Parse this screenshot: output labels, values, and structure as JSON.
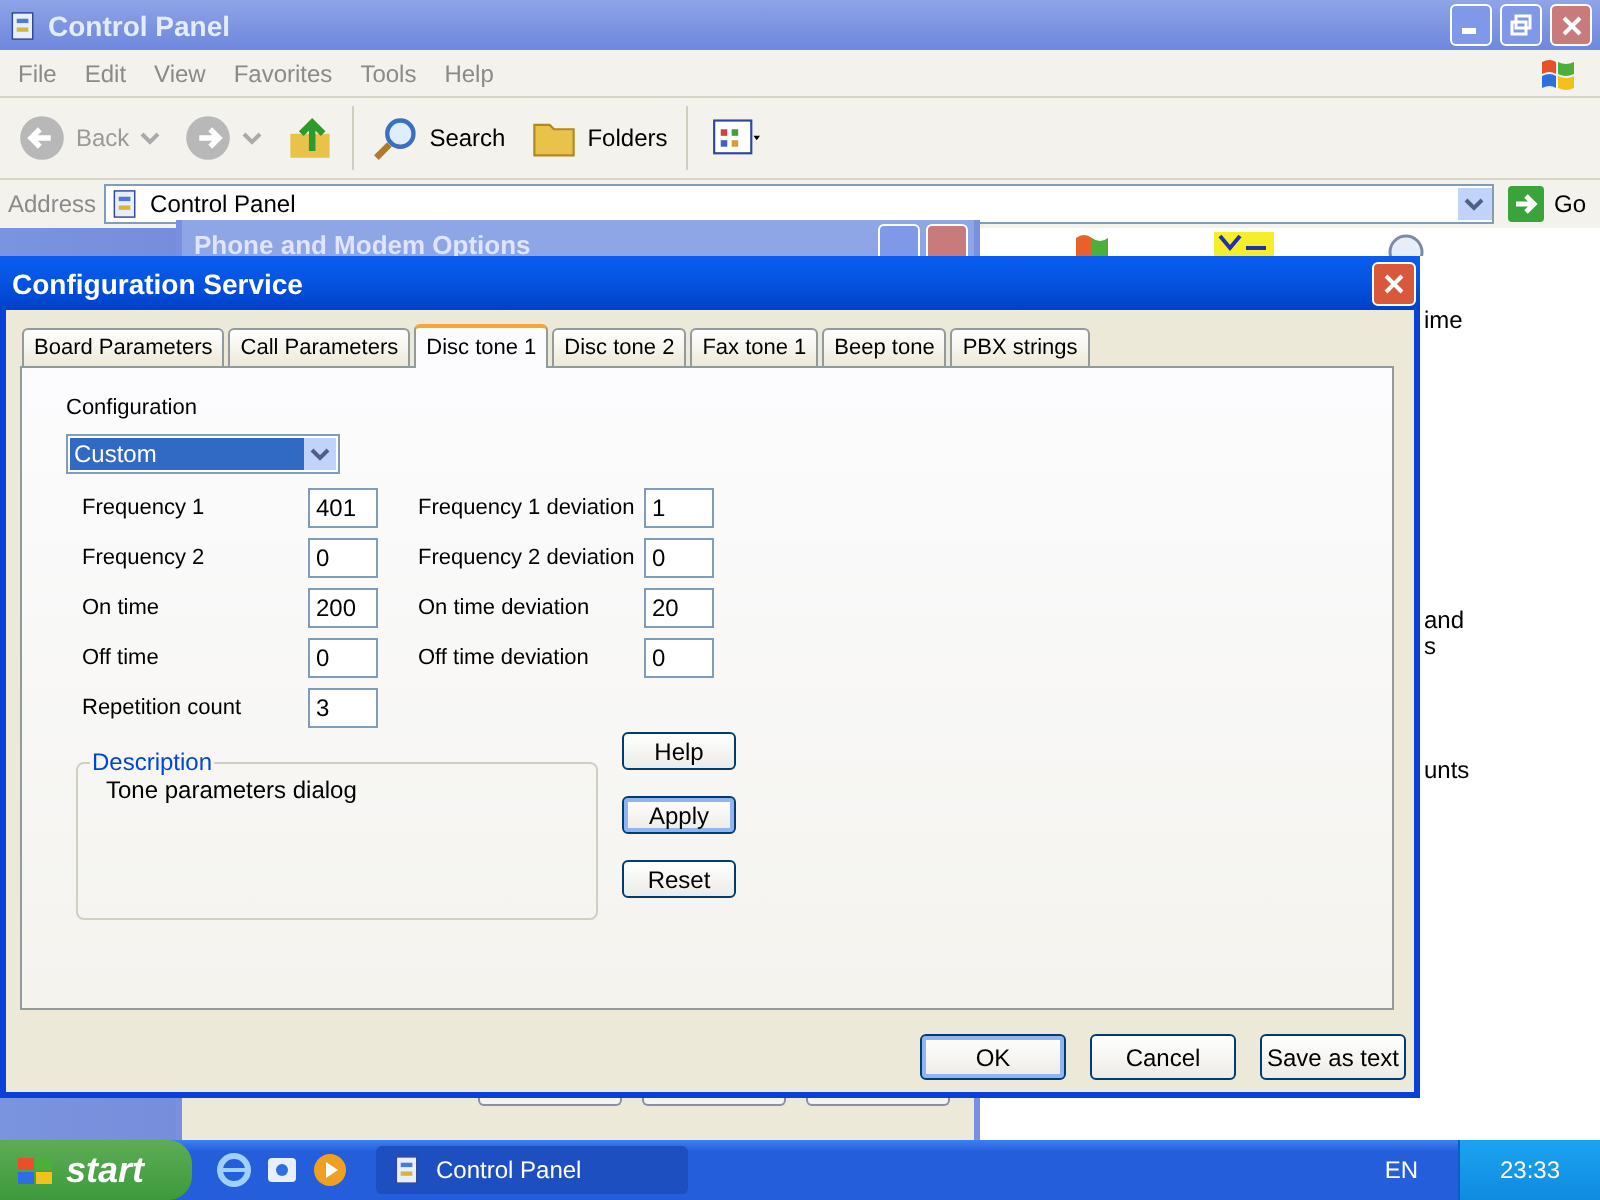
{
  "explorer": {
    "title": "Control Panel",
    "menu": [
      "File",
      "Edit",
      "View",
      "Favorites",
      "Tools",
      "Help"
    ],
    "toolbar": [
      {
        "kind": "back",
        "label": "Back"
      },
      {
        "kind": "forward"
      },
      {
        "kind": "up"
      },
      {
        "kind": "search",
        "label": "Search"
      },
      {
        "kind": "folders",
        "label": "Folders"
      },
      {
        "kind": "views"
      }
    ],
    "address_label": "Address",
    "address": "Control Panel",
    "go": "Go",
    "fragments": [
      "ime",
      "and",
      "s",
      "unts"
    ]
  },
  "background_window": {
    "title": "Phone and Modem Options"
  },
  "dialog": {
    "title": "Configuration Service",
    "tabs": [
      {
        "label": "Board Parameters",
        "selected": false
      },
      {
        "label": "Call Parameters",
        "selected": false
      },
      {
        "label": "Disc tone 1",
        "selected": true
      },
      {
        "label": "Disc tone 2",
        "selected": false
      },
      {
        "label": "Fax tone 1",
        "selected": false
      },
      {
        "label": "Beep tone",
        "selected": false
      },
      {
        "label": "PBX strings",
        "selected": false
      }
    ],
    "configuration_label": "Configuration",
    "configuration": "Custom",
    "rows": [
      {
        "left": {
          "label": "Frequency 1",
          "value": "401"
        },
        "right": {
          "label": "Frequency 1 deviation",
          "value": "1"
        }
      },
      {
        "left": {
          "label": "Frequency 2",
          "value": "0"
        },
        "right": {
          "label": "Frequency 2 deviation",
          "value": "0"
        }
      },
      {
        "left": {
          "label": "On time",
          "value": "200"
        },
        "right": {
          "label": "On time deviation",
          "value": "20"
        }
      },
      {
        "left": {
          "label": "Off time",
          "value": "0"
        },
        "right": {
          "label": "Off time deviation",
          "value": "0"
        }
      },
      {
        "left": {
          "label": "Repetition count",
          "value": "3"
        }
      }
    ],
    "description": {
      "legend": "Description",
      "text": "Tone parameters dialog"
    },
    "side_buttons": [
      {
        "label": "Help",
        "focused": false
      },
      {
        "label": "Apply",
        "focused": true
      },
      {
        "label": "Reset",
        "focused": false
      }
    ],
    "buttons": [
      {
        "label": "OK",
        "default": true
      },
      {
        "label": "Cancel",
        "default": false
      },
      {
        "label": "Save as text",
        "default": false
      }
    ]
  },
  "taskbar": {
    "start": "start",
    "tasks": [
      {
        "label": "Control Panel",
        "selected": true
      }
    ],
    "language": "EN",
    "clock": "23:33"
  }
}
